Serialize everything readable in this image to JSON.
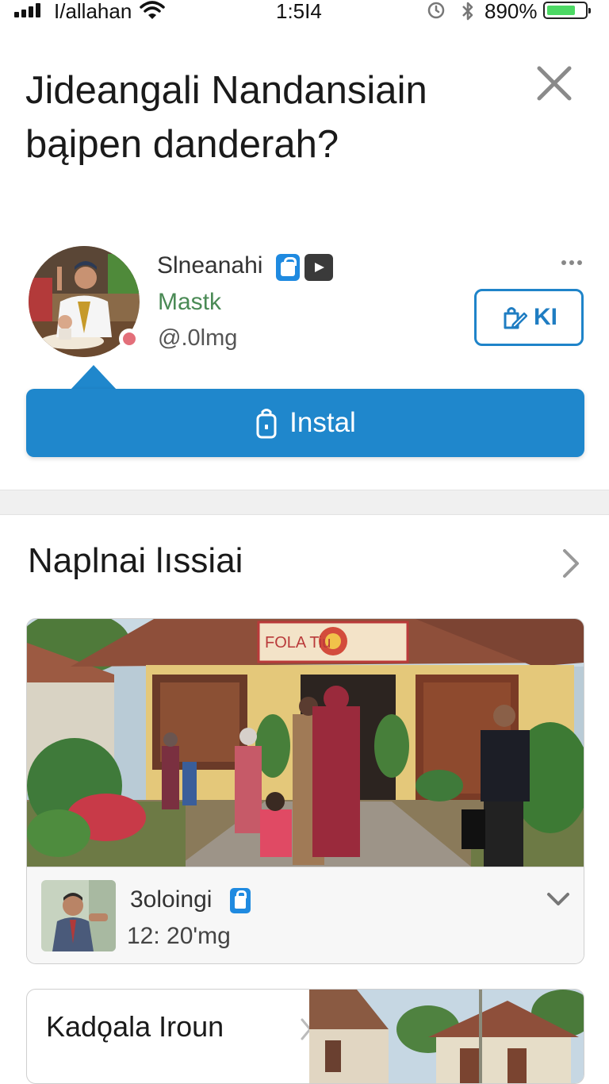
{
  "status_bar": {
    "carrier": "I/allahan",
    "time": "1:5I4",
    "battery_pct": "890%",
    "battery_level": 0.75,
    "icons": [
      "signal-icon",
      "wifi-icon",
      "alarm-icon",
      "bluetooth-icon",
      "battery-icon"
    ]
  },
  "header": {
    "title": "Jideangali Nandansiain bąipen danderah?",
    "close_icon": "close-icon"
  },
  "profile": {
    "name": "Slneanahi",
    "tag": "Mastk",
    "handle": "@.0lmg",
    "follow_label": "KI",
    "more_icon": "more-icon",
    "badge_color": "#e36f7a"
  },
  "install": {
    "label": "Instal",
    "color": "#1f87cc"
  },
  "section": {
    "title": "Naplnai lıssiai"
  },
  "post": {
    "banner_text": "FOLA Tiu",
    "author": "3oloingi",
    "time": "12: 20'mg"
  },
  "card2": {
    "title": "Kadǫala Iroun"
  },
  "colors": {
    "accent": "#1f87cc",
    "tag_green": "#4a8a55",
    "battery_green": "#4cd964"
  }
}
